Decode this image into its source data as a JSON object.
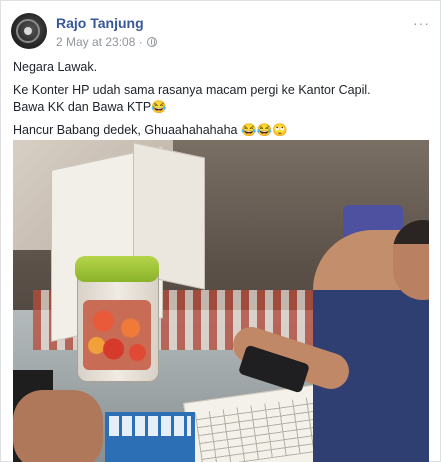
{
  "post": {
    "author": "Rajo Tanjung",
    "timestamp": "2 May at 23:08 ·",
    "more_icon": "···",
    "paragraphs": [
      "Negara Lawak.",
      "Ke Konter HP udah sama rasanya macam pergi ke Kantor Capil.",
      "Bawa KK dan Bawa KTP😂",
      "Hancur Babang dedek, Ghuaahahahaha 😂😂🙄"
    ]
  },
  "icons": {
    "avatar": "profile-avatar",
    "privacy": "globe-icon",
    "more": "more-options-icon"
  },
  "colors": {
    "author_link": "#385898",
    "meta_text": "#90949c",
    "body_text": "#1d2129"
  }
}
